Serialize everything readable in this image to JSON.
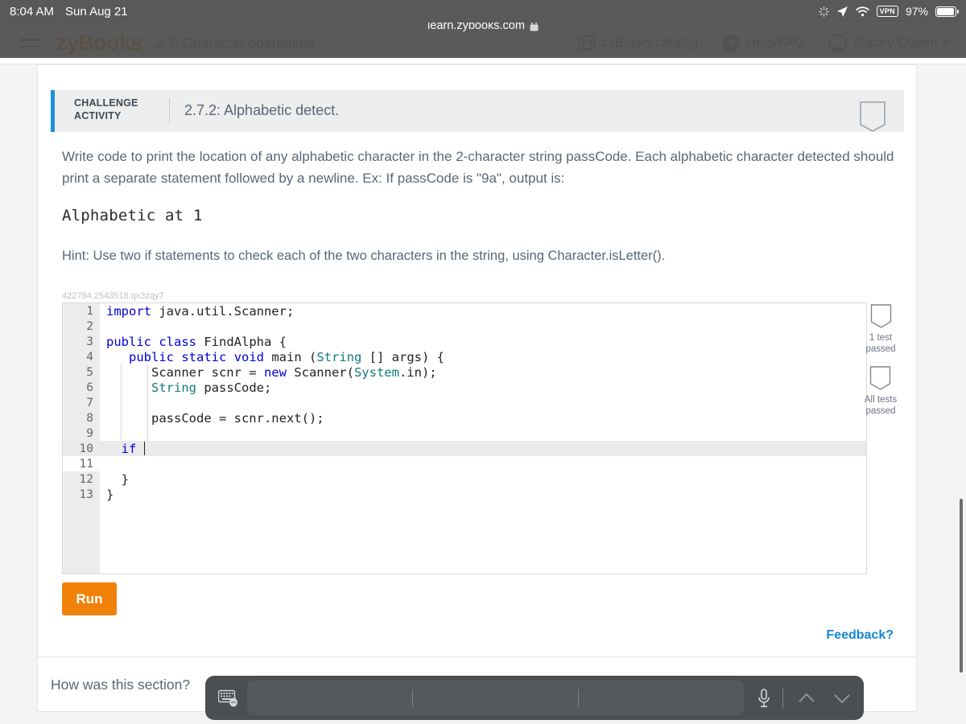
{
  "status_bar": {
    "time": "8:04 AM",
    "date": "Sun Aug 21",
    "spinner_icon": "sync-spinner-icon",
    "location_icon": "location-arrow-icon",
    "wifi_icon": "wifi-icon",
    "vpn_label": "VPN",
    "battery_percent": "97%",
    "battery_icon": "battery-full-icon"
  },
  "browser": {
    "url": "learn.zybooks.com",
    "lock_icon": "lock-icon",
    "drag_handle": "tab-drag-handle"
  },
  "nav": {
    "menu_icon": "hamburger-menu-icon",
    "logo": "zyBooks",
    "section_title": "2.7: Character operations",
    "catalog_label": "zyBooks catalog",
    "catalog_icon": "catalog-icon",
    "help_label": "Help/FAQ",
    "help_icon": "help-circle-icon",
    "user_name": "Stacey Queen",
    "user_icon": "avatar-icon",
    "caret": "▾"
  },
  "challenge": {
    "label_line1": "CHALLENGE",
    "label_line2": "ACTIVITY",
    "title": "2.7.2: Alphabetic detect.",
    "bookmark_icon": "bookmark-outline-icon",
    "accent_color": "#1c8fd8"
  },
  "prose": {
    "paragraph": "Write code to print the location of any alphabetic character in the 2-character string passCode. Each alphabetic character detected should print a separate statement followed by a newline. Ex: If passCode is \"9a\", output is:",
    "sample_output": "Alphabetic at 1",
    "hint": "Hint: Use two if statements to check each of the two characters in the string, using Character.isLetter()."
  },
  "editor": {
    "id": "422784.2543518.qx3zqy7",
    "active_line": 10,
    "lines": [
      {
        "n": "1",
        "html": "<span class=\"kw\">import</span> java.util.Scanner;"
      },
      {
        "n": "2",
        "html": ""
      },
      {
        "n": "3",
        "html": "<span class=\"kw\">public</span> <span class=\"kw\">class</span> FindAlpha {"
      },
      {
        "n": "4",
        "html": "   <span class=\"kw\">public</span> <span class=\"kw\">static</span> <span class=\"kw\">void</span> main (<span class=\"ty\">String</span> [] args) {"
      },
      {
        "n": "5",
        "html": "      Scanner scnr = <span class=\"kw\">new</span> Scanner(<span class=\"ty\">System</span>.in);"
      },
      {
        "n": "6",
        "html": "      <span class=\"ty\">String</span> passCode;"
      },
      {
        "n": "7",
        "html": ""
      },
      {
        "n": "8",
        "html": "      passCode = scnr.next();"
      },
      {
        "n": "9",
        "html": ""
      },
      {
        "n": "10",
        "html": "  <span class=\"kw\">if</span> <span class=\"caret\"></span>"
      },
      {
        "n": "11",
        "html": ""
      },
      {
        "n": "12",
        "html": "  }"
      },
      {
        "n": "13",
        "html": "}"
      }
    ]
  },
  "tests": {
    "badges": [
      {
        "icon": "shield-badge-icon",
        "line1": "1 test",
        "line2": "passed"
      },
      {
        "icon": "shield-badge-icon",
        "line1": "All tests",
        "line2": "passed"
      }
    ]
  },
  "actions": {
    "run_label": "Run",
    "run_color": "#f0820a",
    "feedback_label": "Feedback?",
    "feedback_color": "#1288d4",
    "how_was_section": "How was this section?"
  },
  "keyboard_bar": {
    "keyboard_icon": "keyboard-dictation-icon",
    "predictions": [
      "",
      "",
      ""
    ],
    "mic_icon": "microphone-icon",
    "up_icon": "chevron-up-icon",
    "down_icon": "chevron-down-icon"
  }
}
